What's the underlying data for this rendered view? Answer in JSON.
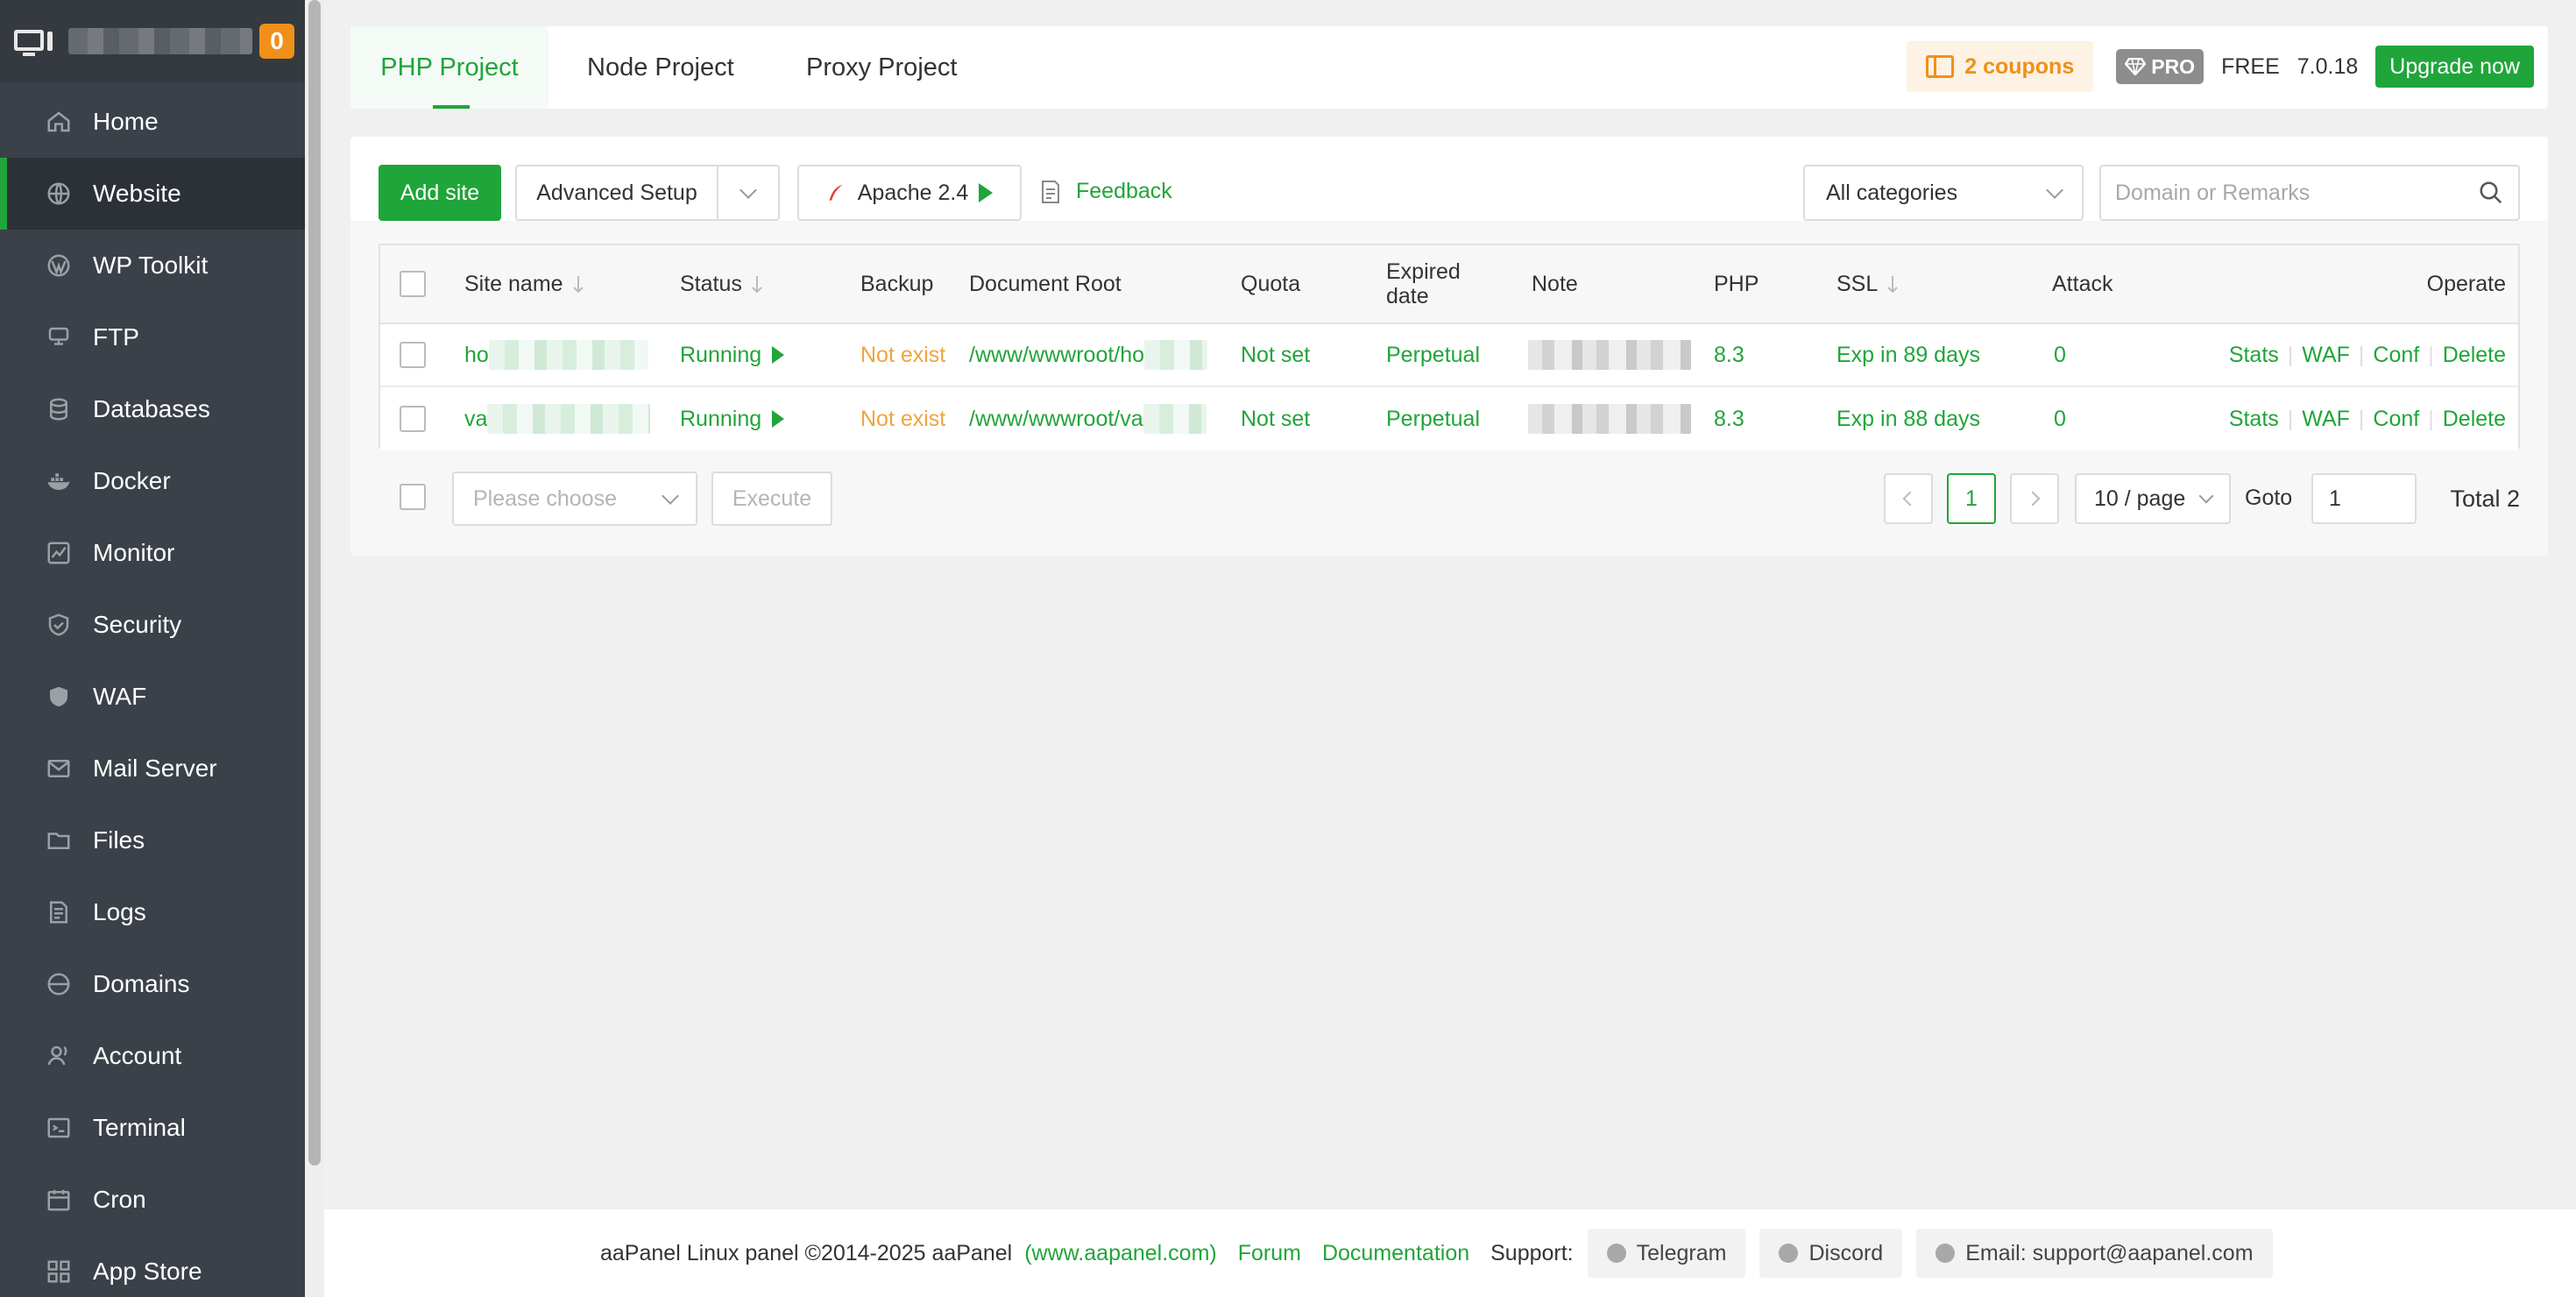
{
  "sidebar": {
    "notice_count": "0",
    "items": [
      {
        "label": "Home",
        "icon": "home-icon"
      },
      {
        "label": "Website",
        "icon": "globe-icon",
        "active": true
      },
      {
        "label": "WP Toolkit",
        "icon": "wordpress-icon"
      },
      {
        "label": "FTP",
        "icon": "ftp-icon"
      },
      {
        "label": "Databases",
        "icon": "database-icon"
      },
      {
        "label": "Docker",
        "icon": "docker-icon"
      },
      {
        "label": "Monitor",
        "icon": "monitor-icon"
      },
      {
        "label": "Security",
        "icon": "shield-icon"
      },
      {
        "label": "WAF",
        "icon": "waf-shield-icon"
      },
      {
        "label": "Mail Server",
        "icon": "mail-icon"
      },
      {
        "label": "Files",
        "icon": "folder-icon"
      },
      {
        "label": "Logs",
        "icon": "logs-icon"
      },
      {
        "label": "Domains",
        "icon": "www-icon"
      },
      {
        "label": "Account",
        "icon": "user-icon"
      },
      {
        "label": "Terminal",
        "icon": "terminal-icon"
      },
      {
        "label": "Cron",
        "icon": "calendar-icon"
      },
      {
        "label": "App Store",
        "icon": "apps-icon"
      }
    ]
  },
  "tabs": [
    "PHP Project",
    "Node Project",
    "Proxy Project"
  ],
  "topbar": {
    "coupons": "2 coupons",
    "pro": "PRO",
    "free": "FREE",
    "version": "7.0.18",
    "upgrade": "Upgrade now"
  },
  "toolbar": {
    "add_site": "Add site",
    "advanced_setup": "Advanced Setup",
    "apache": "Apache 2.4",
    "feedback": "Feedback",
    "category": "All categories",
    "search_placeholder": "Domain or Remarks"
  },
  "table": {
    "headers": {
      "site_name": "Site name",
      "status": "Status",
      "backup": "Backup",
      "doc_root": "Document Root",
      "quota": "Quota",
      "expired_1": "Expired",
      "expired_2": "date",
      "note": "Note",
      "php": "PHP",
      "ssl": "SSL",
      "attack": "Attack",
      "operate": "Operate"
    },
    "rows": [
      {
        "site_prefix": "ho",
        "status": "Running",
        "backup": "Not exist",
        "doc_root": "/www/wwwroot/ho",
        "quota": "Not set",
        "expired": "Perpetual",
        "php": "8.3",
        "ssl": "Exp in 89 days",
        "attack": "0"
      },
      {
        "site_prefix": "va",
        "status": "Running",
        "backup": "Not exist",
        "doc_root": "/www/wwwroot/va",
        "quota": "Not set",
        "expired": "Perpetual",
        "php": "8.3",
        "ssl": "Exp in 88 days",
        "attack": "0"
      }
    ],
    "ops": [
      "Stats",
      "WAF",
      "Conf",
      "Delete"
    ]
  },
  "batch": {
    "placeholder": "Please choose",
    "execute": "Execute"
  },
  "pagination": {
    "current": "1",
    "per_page": "10 / page",
    "goto_label": "Goto",
    "goto_value": "1",
    "total": "Total 2"
  },
  "footer": {
    "copyright": "aaPanel Linux panel ©2014-2025 aaPanel",
    "site_link": "(www.aapanel.com)",
    "forum": "Forum",
    "documentation": "Documentation",
    "support": "Support:",
    "telegram": "Telegram",
    "discord": "Discord",
    "email": "Email: support@aapanel.com"
  },
  "colors": {
    "brand_green": "#20a53a",
    "sidebar_bg": "#3b4148",
    "warning_orange": "#f0901a"
  }
}
